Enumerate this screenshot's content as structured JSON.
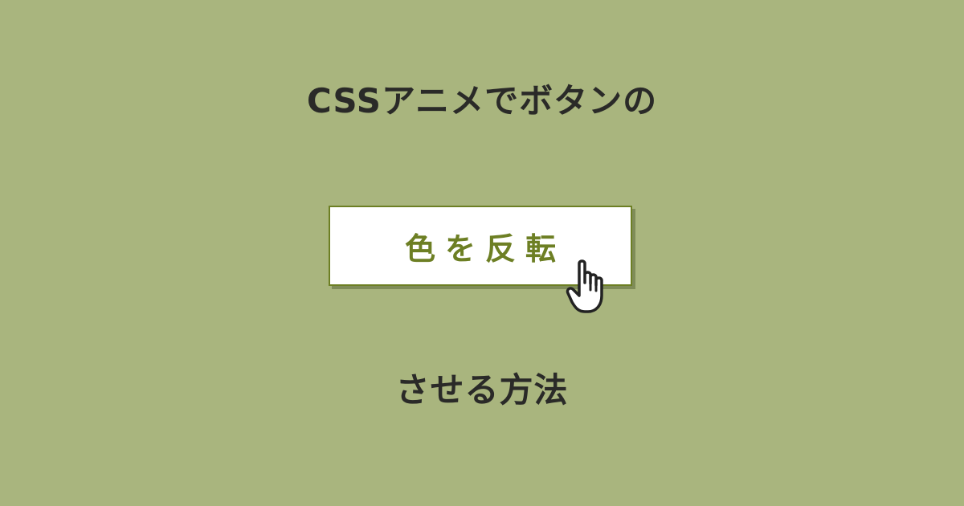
{
  "heading": {
    "line1": "CSSアニメでボタンの",
    "line2": "させる方法"
  },
  "demo_button": {
    "label": "色を反転"
  },
  "cursor": {
    "icon": "hand-pointer-icon"
  },
  "colors": {
    "background": "#a9b57e",
    "text": "#2a2a28",
    "accent": "#6d7f24",
    "button_background": "#ffffff"
  }
}
